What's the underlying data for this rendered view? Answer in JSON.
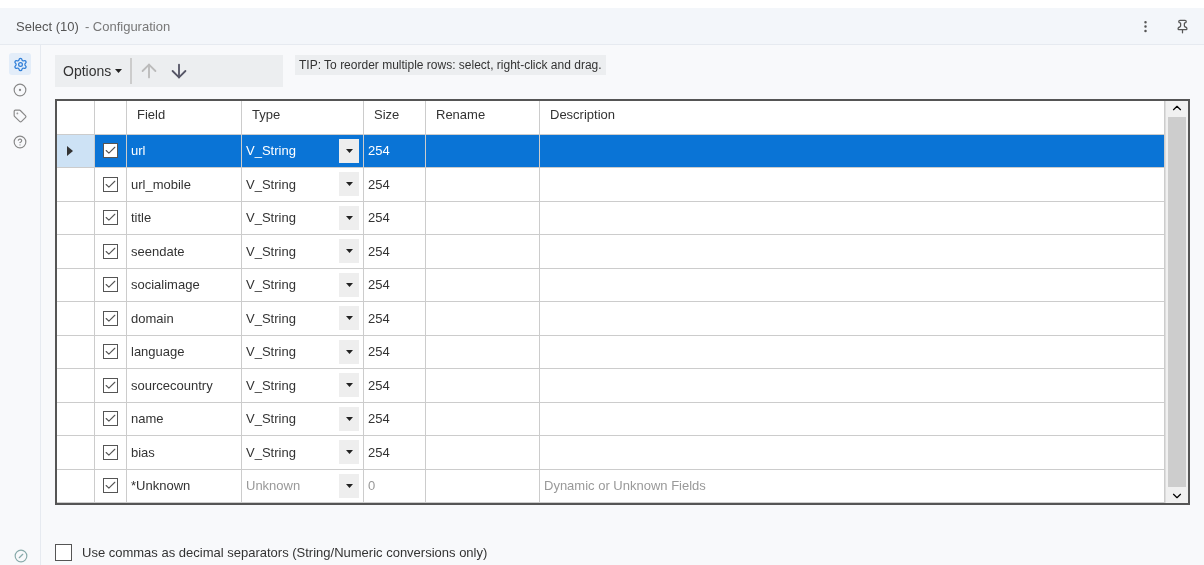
{
  "header": {
    "title": "Select (10)",
    "subtitle": "- Configuration"
  },
  "sidebar": {
    "items": [
      {
        "selected": true
      },
      {
        "selected": false
      },
      {
        "selected": false
      },
      {
        "selected": false
      }
    ]
  },
  "toolbar": {
    "options_label": "Options",
    "up_disabled": true,
    "down_disabled": false,
    "tip": "TIP: To reorder multiple rows: select, right-click and drag."
  },
  "table": {
    "columns": [
      "Field",
      "Type",
      "Size",
      "Rename",
      "Description"
    ],
    "rows": [
      {
        "selected": true,
        "checked": true,
        "greyed": false,
        "field": "url",
        "type": "V_String",
        "size": "254"
      },
      {
        "selected": false,
        "checked": true,
        "greyed": false,
        "field": "url_mobile",
        "type": "V_String",
        "size": "254"
      },
      {
        "selected": false,
        "checked": true,
        "greyed": false,
        "field": "title",
        "type": "V_String",
        "size": "254"
      },
      {
        "selected": false,
        "checked": true,
        "greyed": false,
        "field": "seendate",
        "type": "V_String",
        "size": "254"
      },
      {
        "selected": false,
        "checked": true,
        "greyed": false,
        "field": "socialimage",
        "type": "V_String",
        "size": "254"
      },
      {
        "selected": false,
        "checked": true,
        "greyed": false,
        "field": "domain",
        "type": "V_String",
        "size": "254"
      },
      {
        "selected": false,
        "checked": true,
        "greyed": false,
        "field": "language",
        "type": "V_String",
        "size": "254"
      },
      {
        "selected": false,
        "checked": true,
        "greyed": false,
        "field": "sourcecountry",
        "type": "V_String",
        "size": "254"
      },
      {
        "selected": false,
        "checked": true,
        "greyed": false,
        "field": "name",
        "type": "V_String",
        "size": "254"
      },
      {
        "selected": false,
        "checked": true,
        "greyed": false,
        "field": "bias",
        "type": "V_String",
        "size": "254"
      },
      {
        "selected": false,
        "checked": true,
        "greyed": true,
        "field": "*Unknown",
        "type": "Unknown",
        "size": "0",
        "description": "Dynamic or Unknown Fields"
      }
    ]
  },
  "decimal_option": {
    "label": "Use commas as decimal separators (String/Numeric conversions only)",
    "checked": false
  }
}
